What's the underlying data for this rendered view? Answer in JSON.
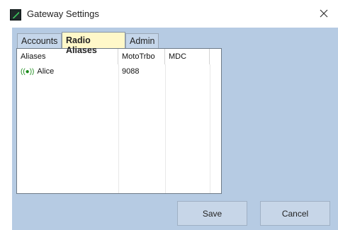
{
  "window": {
    "title": "Gateway Settings",
    "icon": "gateway-app-icon",
    "close_icon": "close-icon"
  },
  "tabs": [
    {
      "label": "Accounts",
      "active": false
    },
    {
      "label": "Radio Aliases",
      "active": true
    },
    {
      "label": "Admin",
      "active": false
    }
  ],
  "grid": {
    "columns": [
      "Aliases",
      "MotoTrbo",
      "MDC"
    ],
    "rows": [
      {
        "icon": "radio-signal-icon",
        "icon_glyph": "((●))",
        "alias": "Alice",
        "mototrbo": "9088",
        "mdc": ""
      }
    ]
  },
  "buttons": {
    "save": "Save",
    "cancel": "Cancel"
  },
  "colors": {
    "client_bg": "#b6cbe3",
    "active_tab": "#fff8c9",
    "radio_icon": "#1a8a1a"
  }
}
